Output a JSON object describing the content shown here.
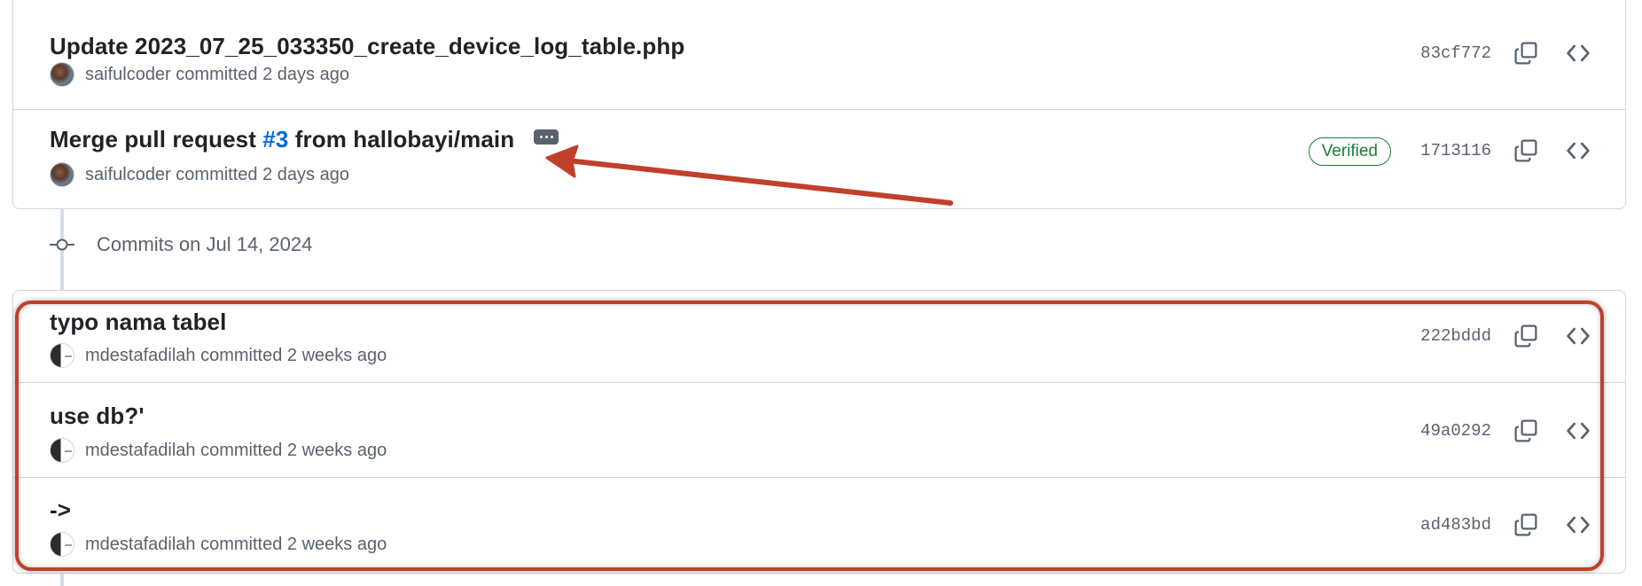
{
  "commits_top": [
    {
      "title": "Update 2023_07_25_033350_create_device_log_table.php",
      "author": "saifulcoder",
      "committed": "committed 2 days ago",
      "sha": "83cf772",
      "verified": null
    },
    {
      "title_prefix": "Merge pull request ",
      "pr_link": "#3",
      "title_suffix": " from hallobayi/main",
      "author": "saifulcoder",
      "committed": "committed 2 days ago",
      "sha": "1713116",
      "verified": "Verified"
    }
  ],
  "group": {
    "label": "Commits on Jul 14, 2024"
  },
  "commits_bottom": [
    {
      "title": "typo nama tabel",
      "author": "mdestafadilah",
      "committed": "committed 2 weeks ago",
      "sha": "222bddd"
    },
    {
      "title": "use db?'",
      "author": "mdestafadilah",
      "committed": "committed 2 weeks ago",
      "sha": "49a0292"
    },
    {
      "title": "->",
      "author": "mdestafadilah",
      "committed": "committed 2 weeks ago",
      "sha": "ad483bd"
    }
  ],
  "icons": {
    "copy": "copy-icon",
    "browse": "code-icon",
    "ellipsis": "kebab-horizontal-icon",
    "commit": "git-commit-icon"
  },
  "colors": {
    "annotation_red": "#c0402a",
    "link_blue": "#0969da",
    "verified_green": "#1a7f37"
  }
}
